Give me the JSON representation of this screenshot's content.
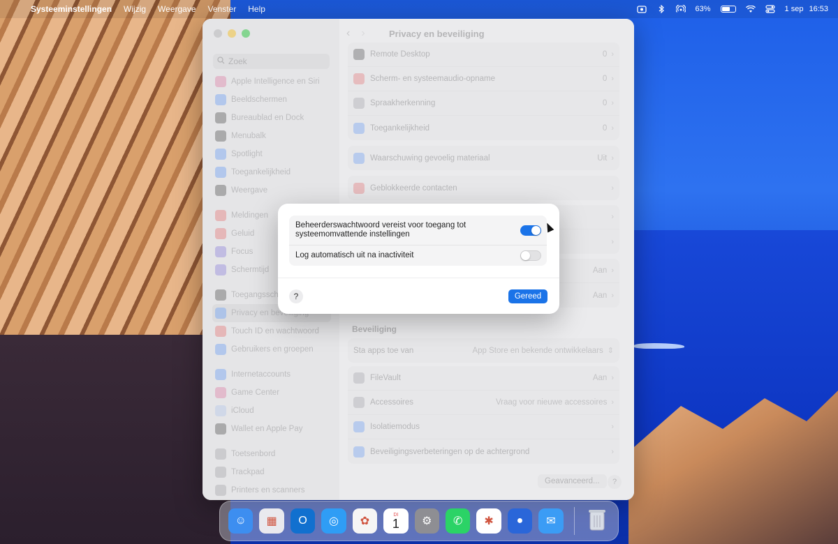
{
  "menubar": {
    "app_name": "Systeeminstellingen",
    "menus": [
      "Wijzig",
      "Weergave",
      "Venster",
      "Help"
    ],
    "battery_percent": "63%",
    "battery_level": 0.63,
    "date": "1 sep",
    "time": "16:53"
  },
  "window": {
    "title": "Privacy en beveiliging",
    "search_placeholder": "Zoek",
    "sidebar": [
      {
        "label": "Apple Intelligence en Siri",
        "color": "#d85a8c"
      },
      {
        "label": "Beeldschermen",
        "color": "#3b82f6"
      },
      {
        "label": "Bureaublad en Dock",
        "color": "#1f1f1f"
      },
      {
        "label": "Menubalk",
        "color": "#1f1f1f"
      },
      {
        "label": "Spotlight",
        "color": "#3b82f6"
      },
      {
        "label": "Toegankelijkheid",
        "color": "#3b82f6"
      },
      {
        "label": "Weergave",
        "color": "#1f1f1f"
      },
      {
        "label": "Meldingen",
        "color": "#e44b4b"
      },
      {
        "label": "Geluid",
        "color": "#e44b4b"
      },
      {
        "label": "Focus",
        "color": "#6b5bd6"
      },
      {
        "label": "Schermtijd",
        "color": "#6b5bd6"
      },
      {
        "label": "Toegangsscherm",
        "color": "#1f1f1f"
      },
      {
        "label": "Privacy en beveiliging",
        "color": "#3b82f6"
      },
      {
        "label": "Touch ID en wachtwoord",
        "color": "#e44b4b"
      },
      {
        "label": "Gebruikers en groepen",
        "color": "#3b82f6"
      },
      {
        "label": "Internetaccounts",
        "color": "#3b82f6"
      },
      {
        "label": "Game Center",
        "color": "#d85a8c"
      },
      {
        "label": "iCloud",
        "color": "#9fb8e8"
      },
      {
        "label": "Wallet en Apple Pay",
        "color": "#1f1f1f"
      },
      {
        "label": "Toetsenbord",
        "color": "#8e8e93"
      },
      {
        "label": "Trackpad",
        "color": "#8e8e93"
      },
      {
        "label": "Printers en scanners",
        "color": "#8e8e93"
      }
    ],
    "rows_top": [
      {
        "label": "Remote Desktop",
        "value": "0",
        "color": "#1f1f1f"
      },
      {
        "label": "Scherm- en systeemaudio-opname",
        "value": "0",
        "color": "#e44b4b"
      },
      {
        "label": "Spraakherkenning",
        "value": "0",
        "color": "#8e8e93"
      },
      {
        "label": "Toegankelijkheid",
        "value": "0",
        "color": "#3b82f6"
      }
    ],
    "row_sensitive": {
      "label": "Waarschuwing gevoelig materiaal",
      "value": "Uit"
    },
    "row_blocked": {
      "label": "Geblokkeerde contacten",
      "value": ""
    },
    "hidden_rows": [
      {
        "value": ""
      },
      {
        "value": ""
      },
      {
        "value": "Aan"
      },
      {
        "value": "Aan"
      }
    ],
    "security_title": "Beveiliging",
    "allow_apps_label": "Sta apps toe van",
    "allow_apps_value": "App Store en bekende ontwikkelaars",
    "rows_bottom": [
      {
        "label": "FileVault",
        "value": "Aan",
        "color": "#8e8e93"
      },
      {
        "label": "Accessoires",
        "value": "Vraag voor nieuwe accessoires",
        "color": "#8e8e93"
      },
      {
        "label": "Isolatiemodus",
        "value": "",
        "color": "#3b82f6"
      },
      {
        "label": "Beveiligingsverbeteringen op de achtergrond",
        "value": "",
        "color": "#3b82f6"
      }
    ],
    "advanced_button": "Geavanceerd...",
    "help_button": "?"
  },
  "sheet": {
    "row1_label": "Beheerderswachtwoord vereist voor toegang tot systeemomvattende instellingen",
    "row1_on": true,
    "row2_label": "Log automatisch uit na inactiviteit",
    "row2_on": false,
    "help_button": "?",
    "done_button": "Gereed"
  },
  "dock": {
    "apps": [
      {
        "name": "finder-app",
        "color": "#3d8ef0",
        "glyph": "☺"
      },
      {
        "name": "launchpad-app",
        "color": "#e9e9ee",
        "glyph": "▦"
      },
      {
        "name": "outlook-app",
        "color": "#1170cf",
        "glyph": "O"
      },
      {
        "name": "safari-app",
        "color": "#2f9df5",
        "glyph": "◎"
      },
      {
        "name": "photos-app",
        "color": "#f5f5f5",
        "glyph": "✿"
      },
      {
        "name": "calendar-app",
        "color": "#ffffff",
        "glyph": "1"
      },
      {
        "name": "system-settings-app",
        "color": "#8e8e93",
        "glyph": "⚙"
      },
      {
        "name": "whatsapp-app",
        "color": "#2bd366",
        "glyph": "✆"
      },
      {
        "name": "slack-app",
        "color": "#ffffff",
        "glyph": "✱"
      },
      {
        "name": "app-store-connect-app",
        "color": "#2a66d9",
        "glyph": "●"
      },
      {
        "name": "mail-app",
        "color": "#3b9cf5",
        "glyph": "✉"
      }
    ],
    "calendar_day": "DI",
    "calendar_date": "1"
  }
}
